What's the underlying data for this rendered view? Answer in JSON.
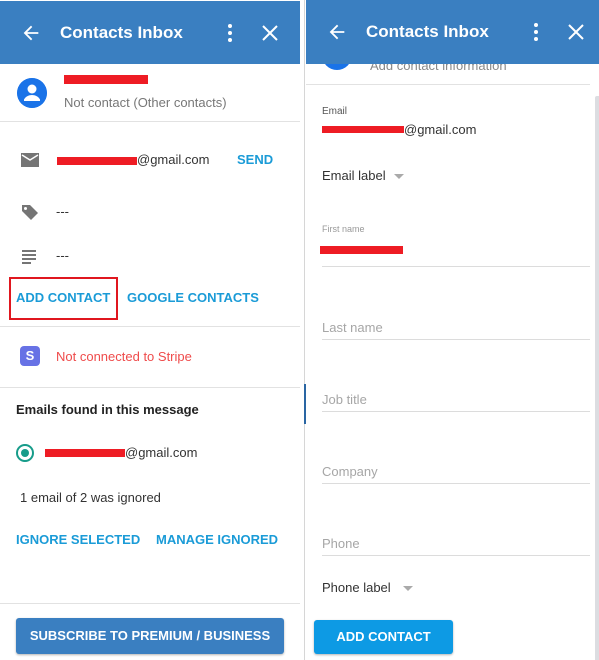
{
  "app": {
    "title": "Contacts Inbox"
  },
  "left_panel": {
    "header": {
      "title": "Contacts Inbox",
      "back_icon": "arrow-left-icon",
      "more_icon": "more-vert-icon",
      "close_icon": "close-icon"
    },
    "contact": {
      "avatar_icon": "account-circle-icon",
      "name_redacted": true,
      "status": "Not contact (Other contacts)"
    },
    "details": {
      "email_icon": "mail-icon",
      "email_suffix": "@gmail.com",
      "send_label": "SEND",
      "tag_icon": "label-icon",
      "tag_value": "---",
      "notes_icon": "notes-icon",
      "notes_value": "---"
    },
    "actions": {
      "add_contact_label": "ADD CONTACT",
      "google_contacts_label": "GOOGLE CONTACTS"
    },
    "stripe": {
      "icon_letter": "S",
      "status": "Not connected to Stripe"
    },
    "emails_found": {
      "title": "Emails found in this message",
      "items": [
        {
          "email_suffix": "@gmail.com",
          "selected": true
        }
      ],
      "ignored_note": "1 email of 2 was ignored",
      "ignore_selected_label": "IGNORE SELECTED",
      "manage_ignored_label": "MANAGE IGNORED"
    },
    "subscribe_label": "SUBSCRIBE TO PREMIUM / BUSINESS"
  },
  "right_panel": {
    "header": {
      "title": "Contacts Inbox",
      "back_icon": "arrow-left-icon",
      "more_icon": "more-vert-icon",
      "close_icon": "close-icon"
    },
    "subheader": "Add contact information",
    "form": {
      "email": {
        "label": "Email",
        "value_suffix": "@gmail.com"
      },
      "email_label_select": "Email label",
      "first_name": {
        "label": "First name",
        "value_redacted": true
      },
      "last_name": {
        "placeholder": "Last name"
      },
      "job_title": {
        "placeholder": "Job title"
      },
      "company": {
        "placeholder": "Company"
      },
      "phone": {
        "placeholder": "Phone"
      },
      "phone_label_select": "Phone label"
    },
    "add_contact_label": "ADD CONTACT"
  },
  "colors": {
    "header_bg": "#3a7fc1",
    "link": "#1a9bd7",
    "error": "#ef4b4b",
    "stripe": "#6772e5",
    "radio": "#179c8a",
    "primary_button": "#0d9ae4",
    "highlight_box": "#e0171f",
    "redaction": "#ee1c24"
  }
}
